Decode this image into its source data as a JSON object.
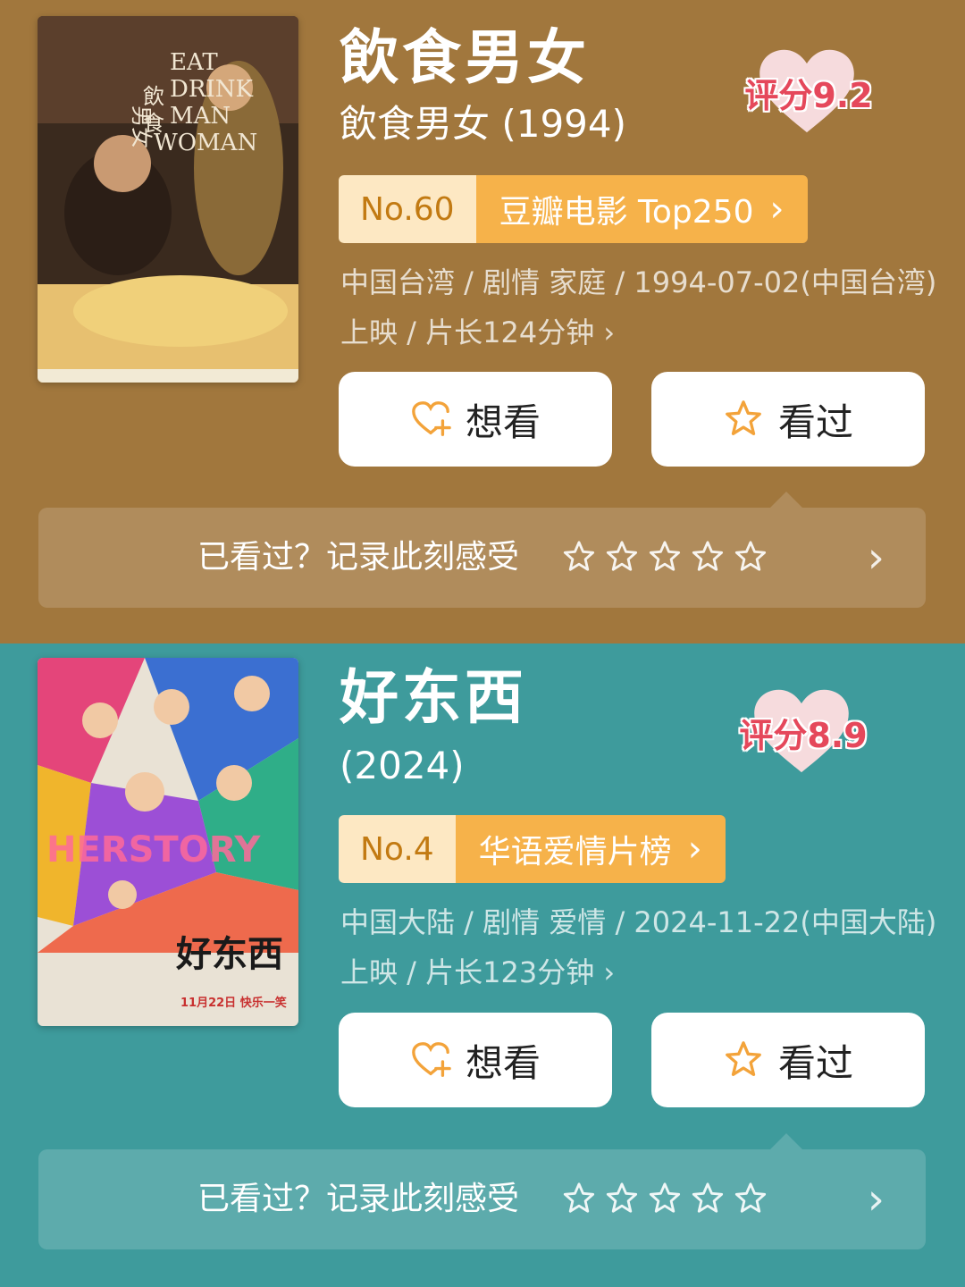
{
  "movies": [
    {
      "title": "飲食男女",
      "subtitle": "飲食男女 (1994)",
      "rating": "评分9.2",
      "rank_no": "No.60",
      "rank_list": "豆瓣电影 Top250",
      "meta_line1": "中国台湾 / 剧情 家庭 / 1994-07-02(中国台湾)",
      "meta_line2": "上映 / 片长124分钟 ›",
      "want_label": "想看",
      "seen_label": "看过",
      "prompt": "已看过？记录此刻感受",
      "poster_text": [
        "EAT",
        "DRINK",
        "MAN",
        "WOMAN",
        "飲",
        "食",
        "男女"
      ],
      "colors": {
        "bg": "#a1773d",
        "heart": "#f6dbdd"
      }
    },
    {
      "title": "好东西",
      "subtitle": "(2024)",
      "rating": "评分8.9",
      "rank_no": "No.4",
      "rank_list": "华语爱情片榜",
      "meta_line1": "中国大陆 / 剧情 爱情 / 2024-11-22(中国大陆)",
      "meta_line2": "上映 / 片长123分钟 ›",
      "want_label": "想看",
      "seen_label": "看过",
      "prompt": "已看过？记录此刻感受",
      "poster_text": [
        "HERSTORY",
        "好东西",
        "11月22日 快乐一笑"
      ],
      "colors": {
        "bg": "#3e9b9c",
        "heart": "#f6dbdd"
      }
    }
  ],
  "icons": {
    "want": "heart-plus-icon",
    "seen": "star-outline-icon",
    "chevron": "chevron-right-icon"
  },
  "accent": {
    "orange": "#f6b24a",
    "rating_red": "#e5485b",
    "rank_text": "#c27a12"
  }
}
